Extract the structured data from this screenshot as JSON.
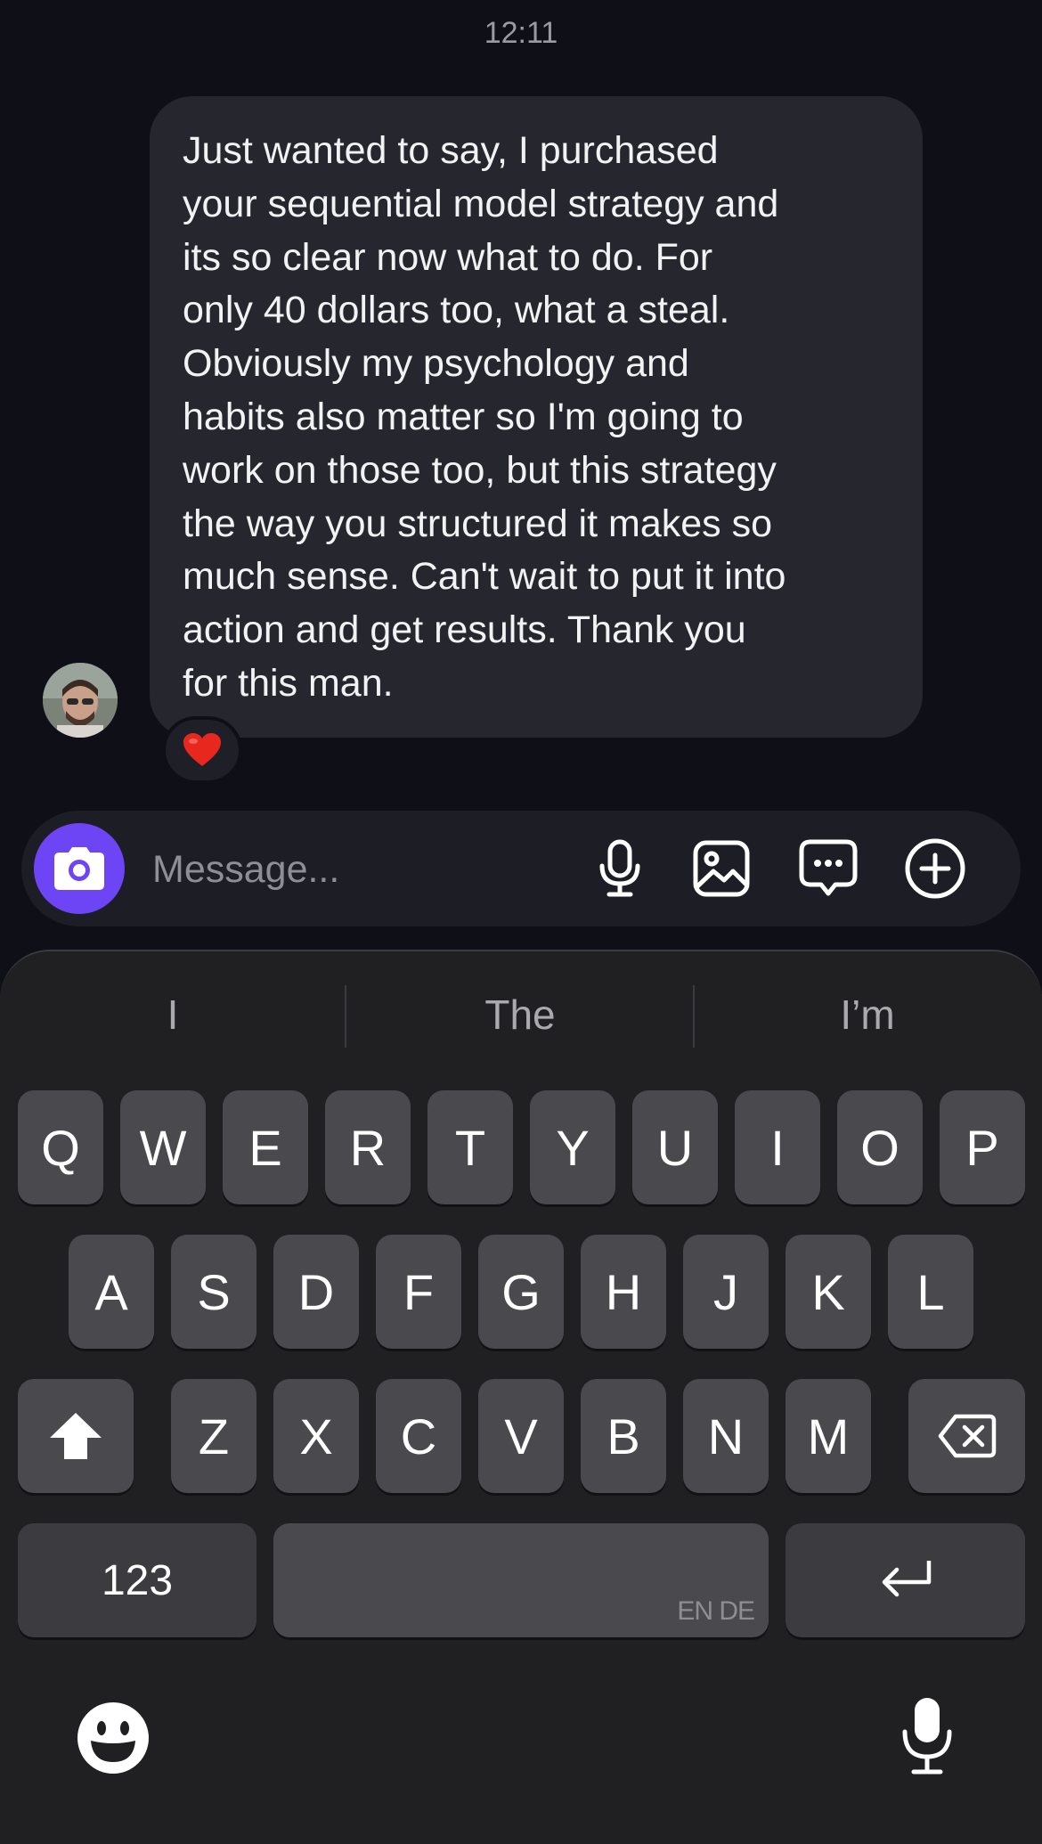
{
  "status": {
    "time": "12:11"
  },
  "conversation": {
    "message_text": "Just wanted to say, I purchased\nyour  sequential model strategy and\nits so clear now what to do.  For\nonly 40 dollars too, what a steal.\nObviously my psychology and\nhabits also matter so I'm going to\nwork on those too, but this strategy\nthe way you structured it makes so\nmuch sense. Can't wait to put it into\naction and get results. Thank you\nfor this man.",
    "reaction": "heart"
  },
  "composer": {
    "placeholder": "Message...",
    "icons": [
      "camera-icon",
      "microphone-icon",
      "image-icon",
      "chat-bubble-icon",
      "plus-circle-icon"
    ],
    "accent_color": "#6d45f5"
  },
  "keyboard": {
    "suggestions": [
      "I",
      "The",
      "I’m"
    ],
    "row1": [
      "Q",
      "W",
      "E",
      "R",
      "T",
      "Y",
      "U",
      "I",
      "O",
      "P"
    ],
    "row2": [
      "A",
      "S",
      "D",
      "F",
      "G",
      "H",
      "J",
      "K",
      "L"
    ],
    "row3": [
      "Z",
      "X",
      "C",
      "V",
      "B",
      "N",
      "M"
    ],
    "numbers_label": "123",
    "space_language": "EN DE",
    "icons": [
      "shift-icon",
      "backspace-icon",
      "return-icon",
      "emoji-icon",
      "dictation-icon"
    ]
  }
}
